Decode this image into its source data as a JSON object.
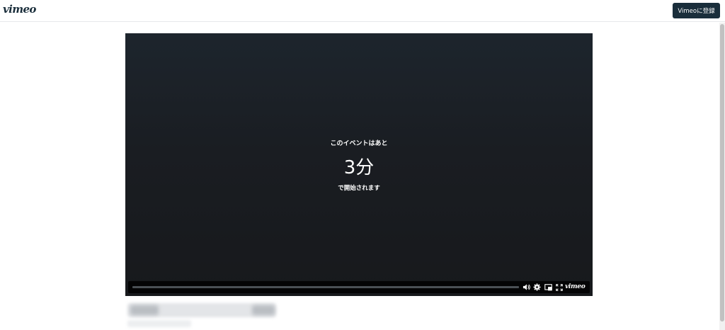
{
  "header": {
    "logo_text": "vimeo",
    "join_button_label": "Vimeoに登録"
  },
  "player": {
    "countdown": {
      "pre_text": "このイベントはあと",
      "time_text": "3分",
      "post_text": "で開始されます"
    },
    "controls": {
      "icons": [
        "volume-icon",
        "settings-gear-icon",
        "picture-in-picture-icon",
        "fullscreen-icon"
      ],
      "brand_text": "vimeo"
    }
  }
}
